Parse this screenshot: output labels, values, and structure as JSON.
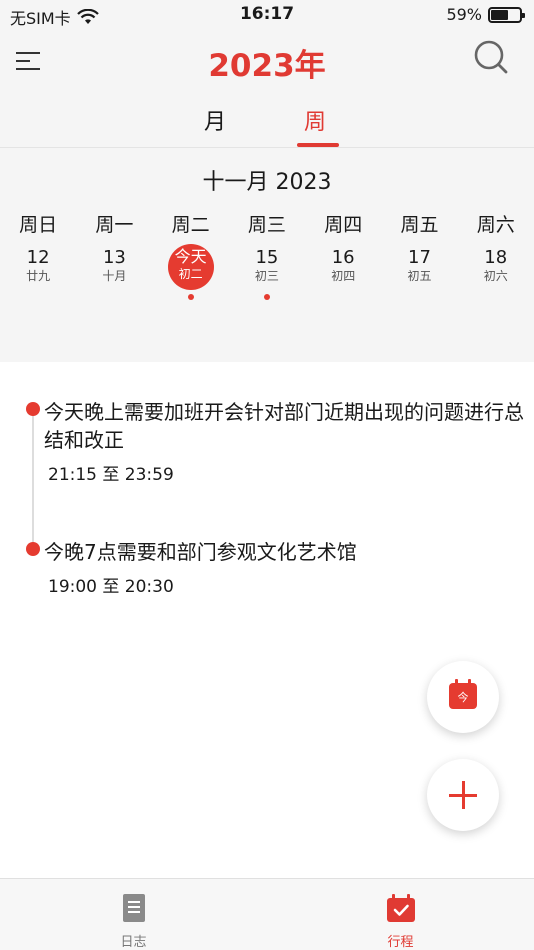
{
  "status_bar": {
    "carrier": "无SIM卡",
    "time": "16:17",
    "battery_percent": "59%",
    "battery_level": 0.59
  },
  "header": {
    "title": "2023年"
  },
  "view_tabs": [
    {
      "label": "月",
      "selected": false
    },
    {
      "label": "周",
      "selected": true
    }
  ],
  "calendar": {
    "month_title": "十一月 2023",
    "weekdays": [
      "周日",
      "周一",
      "周二",
      "周三",
      "周四",
      "周五",
      "周六"
    ],
    "dates": [
      {
        "num": "12",
        "lunar": "廿九"
      },
      {
        "num": "13",
        "lunar": "十月"
      },
      {
        "num": "今天",
        "lunar": "初二",
        "today": true,
        "has_event": true
      },
      {
        "num": "15",
        "lunar": "初三",
        "has_event": true
      },
      {
        "num": "16",
        "lunar": "初四"
      },
      {
        "num": "17",
        "lunar": "初五"
      },
      {
        "num": "18",
        "lunar": "初六"
      }
    ]
  },
  "events": [
    {
      "title": "今天晚上需要加班开会针对部门近期出现的问题进行总结和改正",
      "time": "21:15 至 23:59"
    },
    {
      "title": "今晚7点需要和部门参观文化艺术馆",
      "time": "19:00 至 20:30"
    }
  ],
  "fab": {
    "today_badge": "今"
  },
  "tabbar": {
    "items": [
      {
        "label": "日志",
        "icon": "document-icon"
      },
      {
        "label": "行程",
        "icon": "calendar-check-icon",
        "selected": true
      }
    ]
  },
  "colors": {
    "accent": "#e03a33",
    "background": "#f5f5f5",
    "card": "#ffffff"
  }
}
